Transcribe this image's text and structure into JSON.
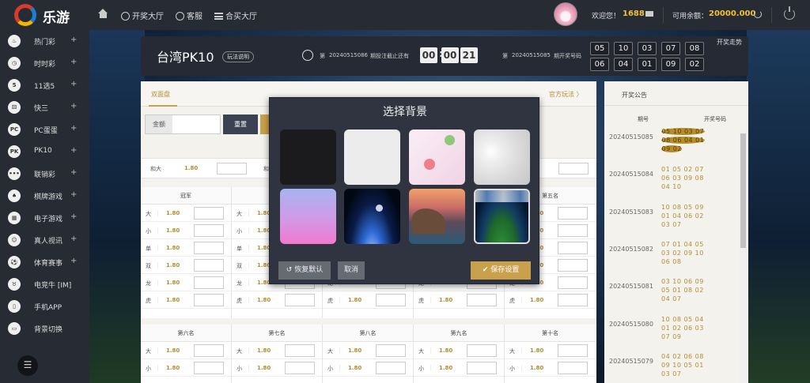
{
  "brand": {
    "name": "乐游"
  },
  "topnav": [
    {
      "label": "开奖大厅",
      "icon": "lottery-hall-icon"
    },
    {
      "label": "客服",
      "icon": "customer-service-icon"
    },
    {
      "label": "合买大厅",
      "icon": "list-icon"
    }
  ],
  "user": {
    "welcome": "欢迎您！",
    "points": "1688",
    "balance_label": "可用余额：",
    "balance": "20000.000"
  },
  "sidebar": {
    "items": [
      {
        "label": "热门彩",
        "icon": "fire-icon",
        "glyph": "♨",
        "plus": "+"
      },
      {
        "label": "时时彩",
        "icon": "clock-icon",
        "glyph": "◷",
        "plus": "+"
      },
      {
        "label": "11选5",
        "icon": "balls-icon",
        "glyph": "5",
        "plus": "+"
      },
      {
        "label": "快三",
        "icon": "dice-icon",
        "glyph": "⚄",
        "plus": "+"
      },
      {
        "label": "PC蛋蛋",
        "icon": "pc-egg-icon",
        "glyph": "PC",
        "plus": "+"
      },
      {
        "label": "PK10",
        "icon": "racing-icon",
        "glyph": "PK",
        "plus": "+"
      },
      {
        "label": "联销彩",
        "icon": "more-icon",
        "glyph": "•••",
        "plus": "+"
      },
      {
        "label": "棋牌游戏",
        "icon": "cards-icon",
        "glyph": "♠",
        "plus": "+"
      },
      {
        "label": "电子游戏",
        "icon": "slot-icon",
        "glyph": "▦",
        "plus": "+"
      },
      {
        "label": "真人视讯",
        "icon": "live-video-icon",
        "glyph": "☺",
        "plus": "+"
      },
      {
        "label": "体育赛事",
        "icon": "soccer-icon",
        "glyph": "⚽",
        "plus": "+"
      },
      {
        "label": "电竞牛 [IM]",
        "icon": "esports-icon",
        "glyph": "♉",
        "plus": ""
      },
      {
        "label": "手机APP",
        "icon": "mobile-icon",
        "glyph": "▯",
        "plus": ""
      },
      {
        "label": "背景切换",
        "icon": "monitor-icon",
        "glyph": "▭",
        "plus": ""
      }
    ],
    "toggle_glyph": "☰"
  },
  "game": {
    "title": "台湾PK10",
    "rules": "玩法说明",
    "issue_prefix": "第",
    "current_issue": "20240515086",
    "countdown_label": "期投注截止还有",
    "countdown": [
      "00",
      "00",
      "21"
    ],
    "last_issue": "20240515085",
    "last_label": "期开奖号码",
    "trend": "开奖走势",
    "balls": [
      "05",
      "10",
      "03",
      "07",
      "08",
      "06",
      "04",
      "01",
      "09",
      "02"
    ]
  },
  "panel": {
    "tab": "双面盘",
    "official": "官方玩法 〉",
    "amount_label": "金额",
    "reset": "重置",
    "he_label": "和大",
    "he_odds": "1.80",
    "he_label2": "和",
    "top_headers": [
      "冠军",
      "",
      "",
      "",
      "第五名"
    ],
    "bottom_headers": [
      "第六名",
      "第七名",
      "第八名",
      "第九名",
      "第十名"
    ],
    "rows": [
      {
        "name": "大",
        "odds": "1.80"
      },
      {
        "name": "小",
        "odds": "1.80"
      },
      {
        "name": "单",
        "odds": "1.80"
      },
      {
        "name": "双",
        "odds": "1.80"
      },
      {
        "name": "龙",
        "odds": "1.80"
      },
      {
        "name": "虎",
        "odds": "1.80"
      }
    ]
  },
  "notice": {
    "title": "开奖公告",
    "col_issue": "期号",
    "col_nums": "开奖号码",
    "rows": [
      {
        "issue": "20240515085",
        "nums": [
          "05 10 03 07",
          "08 06 04 01",
          "09 02"
        ],
        "highlight": true
      },
      {
        "issue": "20240515084",
        "nums": [
          "01 05 02 07",
          "06 03 09 08",
          "04 10"
        ],
        "highlight": false
      },
      {
        "issue": "20240515083",
        "nums": [
          "10 08 05 09",
          "01 04 06 02",
          "03 07"
        ],
        "highlight": false
      },
      {
        "issue": "20240515082",
        "nums": [
          "07 01 04 05",
          "03 02 09 10",
          "06 08"
        ],
        "highlight": false
      },
      {
        "issue": "20240515081",
        "nums": [
          "03 10 06 09",
          "05 01 08 02",
          "04 07"
        ],
        "highlight": false
      },
      {
        "issue": "20240515080",
        "nums": [
          "10 08 05 04",
          "01 02 06 03",
          "07 09"
        ],
        "highlight": false
      },
      {
        "issue": "20240515079",
        "nums": [
          "04 02 06 08",
          "09 10 05 01",
          "03 07"
        ],
        "highlight": false
      }
    ]
  },
  "modal": {
    "title": "选择背景",
    "thumbs": [
      "bg-black",
      "bg-light-gray",
      "bg-pink-balls",
      "bg-bokeh",
      "bg-pink-gradient",
      "bg-space-moon",
      "bg-sunset-rock",
      "bg-stadium"
    ],
    "restore": "↺ 恢复默认",
    "cancel": "取消",
    "save": "✔ 保存设置"
  }
}
